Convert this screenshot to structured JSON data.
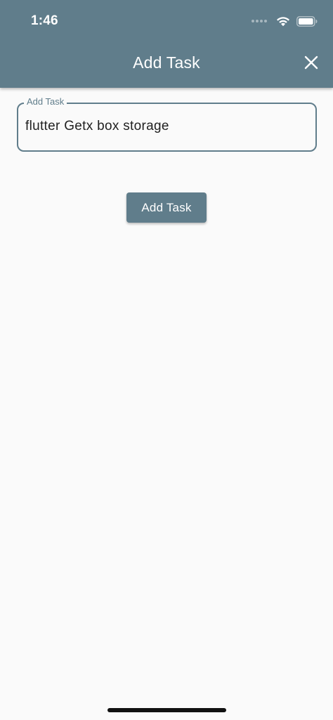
{
  "status_bar": {
    "time": "1:46",
    "icons": [
      "signal-dots-icon",
      "wifi-icon",
      "battery-icon"
    ]
  },
  "app_bar": {
    "title": "Add Task",
    "close_icon": "close-icon"
  },
  "form": {
    "task_field": {
      "label": "Add Task",
      "value": "flutter Getx box storage"
    },
    "submit_label": "Add Task"
  },
  "colors": {
    "primary": "#607d8b",
    "background": "#fafafa",
    "on_primary": "#ffffff",
    "text": "#212121"
  }
}
